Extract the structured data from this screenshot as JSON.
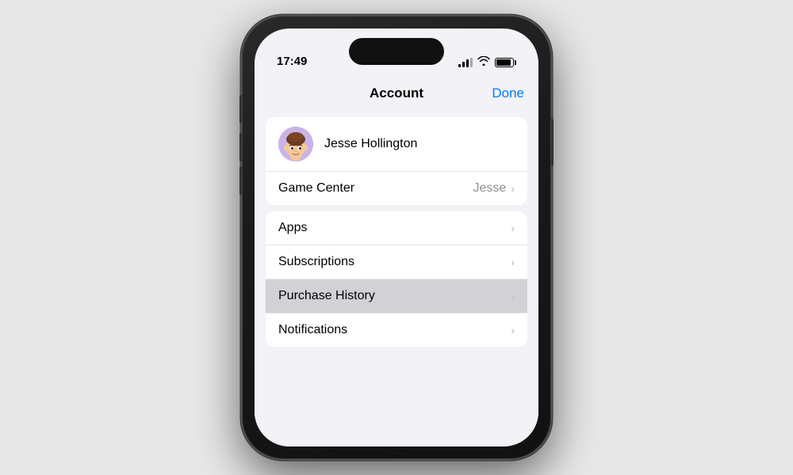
{
  "statusBar": {
    "time": "17:49"
  },
  "sheet": {
    "title": "Account",
    "doneButton": "Done"
  },
  "profile": {
    "name": "Jesse Hollington"
  },
  "gameCenterRow": {
    "label": "Game Center",
    "value": "Jesse"
  },
  "menuItems": [
    {
      "id": "apps",
      "label": "Apps",
      "highlighted": false
    },
    {
      "id": "subscriptions",
      "label": "Subscriptions",
      "highlighted": false
    },
    {
      "id": "purchase-history",
      "label": "Purchase History",
      "highlighted": true
    },
    {
      "id": "notifications",
      "label": "Notifications",
      "highlighted": false
    }
  ],
  "chevron": "›",
  "colors": {
    "blue": "#007AFF",
    "separator": "#e5e5ea",
    "chevron": "#c7c7cc",
    "secondaryText": "#8e8e93"
  }
}
